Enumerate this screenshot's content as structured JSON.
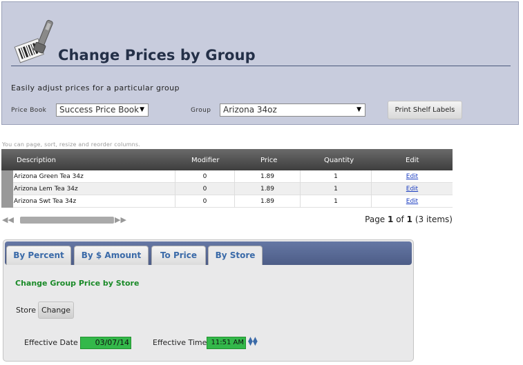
{
  "header": {
    "title": "Change Prices by Group",
    "subtitle": "Easily adjust prices for a particular group",
    "price_book_label": "Price Book",
    "price_book_value": "Success Price Book",
    "group_label": "Group",
    "group_value": "Arizona 34oz",
    "print_button": "Print Shelf Labels"
  },
  "grid": {
    "hint": "You can page, sort, resize and reorder columns.",
    "columns": [
      "Description",
      "Modifier",
      "Price",
      "Quantity",
      "Edit"
    ],
    "rows": [
      {
        "description": "Arizona Green Tea 34z",
        "modifier": "0",
        "price": "1.89",
        "quantity": "1",
        "edit": "Edit"
      },
      {
        "description": "Arizona Lem Tea 34z",
        "modifier": "0",
        "price": "1.89",
        "quantity": "1",
        "edit": "Edit"
      },
      {
        "description": "Arizona Swt Tea 34z",
        "modifier": "0",
        "price": "1.89",
        "quantity": "1",
        "edit": "Edit"
      }
    ],
    "pager": {
      "page_word": "Page",
      "current": "1",
      "of_word": "of",
      "total": "1",
      "items": "(3 items)"
    }
  },
  "tabs": [
    {
      "label": "By Percent"
    },
    {
      "label": "By $ Amount"
    },
    {
      "label": "To Price"
    },
    {
      "label": "By Store"
    }
  ],
  "active_tab": "By Store",
  "panel": {
    "title": "Change Group Price by Store",
    "store_label": "Store",
    "change_button": "Change",
    "effective_date_label": "Effective Date",
    "effective_date_value": "03/07/14",
    "effective_time_label": "Effective Time",
    "effective_time_value": "11:51 AM"
  },
  "colors": {
    "header_bg": "#c8ccdd",
    "title": "#243048",
    "tab_bar": "#5a6b96",
    "tab_text": "#3a6aa8",
    "panel_title": "#1a8a28",
    "input_green": "#33b84a",
    "link": "#1a3cc0"
  },
  "icons": {
    "logo": "barcode-scanner-icon",
    "select_arrow": "triangle-down-icon",
    "pager_first": "double-arrow-left-icon",
    "pager_prev": "arrow-left-icon",
    "pager_next": "arrow-right-icon",
    "pager_last": "double-arrow-right-icon",
    "spinner": "up-down-arrows-icon"
  }
}
